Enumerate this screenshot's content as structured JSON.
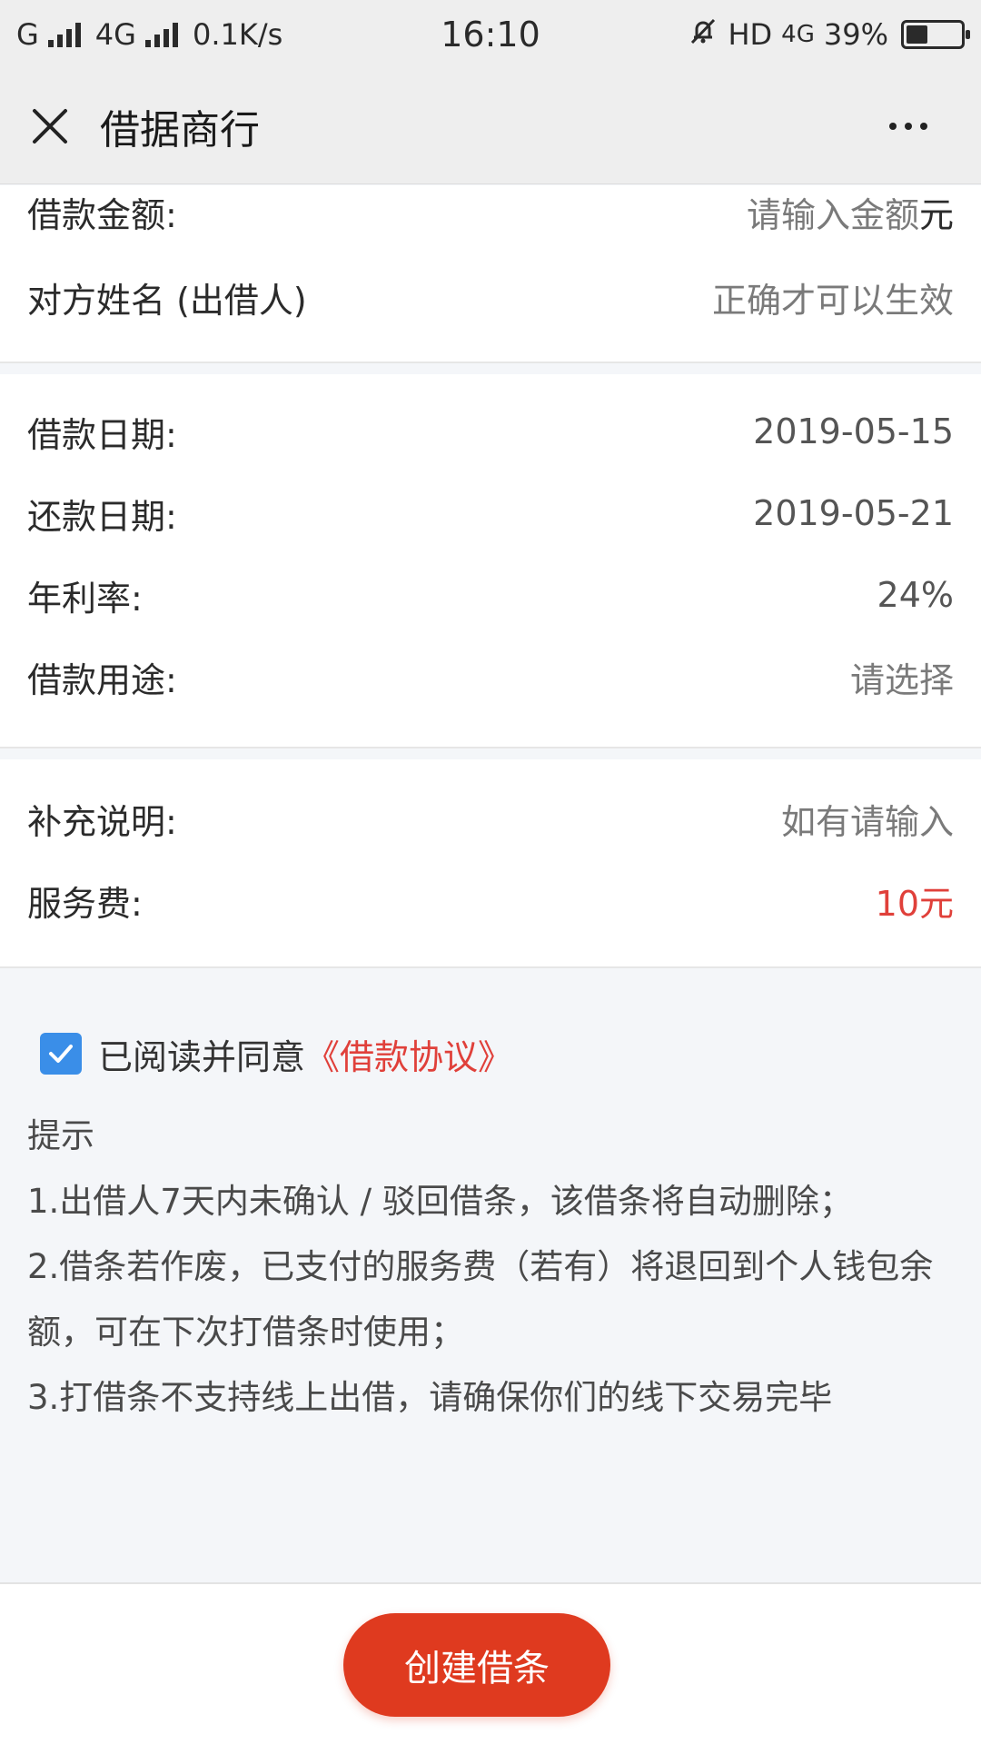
{
  "status_bar": {
    "carrier": "G",
    "network": "4G",
    "speed": "0.1K/s",
    "time": "16:10",
    "hd": "HD",
    "network2": "4G",
    "battery_percent": "39%",
    "battery_level": 0.39
  },
  "header": {
    "title": "借据商行",
    "close_icon": "close-icon",
    "more_icon": "more-dots-icon"
  },
  "form": {
    "amount": {
      "label": "借款金额:",
      "placeholder": "请输入金额",
      "unit": "元"
    },
    "lender_name": {
      "label": "对方姓名 (出借人)",
      "placeholder": "正确才可以生效"
    },
    "loan_date": {
      "label": "借款日期:",
      "value": "2019-05-15"
    },
    "repay_date": {
      "label": "还款日期:",
      "value": "2019-05-21"
    },
    "interest_rate": {
      "label": "年利率:",
      "value": "24%"
    },
    "purpose": {
      "label": "借款用途:",
      "placeholder": "请选择"
    },
    "note": {
      "label": "补充说明:",
      "placeholder": "如有请输入"
    },
    "service_fee": {
      "label": "服务费:",
      "value": "10元"
    }
  },
  "agreement": {
    "checked": true,
    "text": "已阅读并同意",
    "link": "《借款协议》"
  },
  "tips": {
    "title": "提示",
    "items": [
      "1.出借人7天内未确认 / 驳回借条，该借条将自动删除；",
      "2.借条若作废，已支付的服务费（若有）将退回到个人钱包余额，可在下次打借条时使用；",
      "3.打借条不支持线上出借，请确保你们的线下交易完毕"
    ]
  },
  "actions": {
    "create_label": "创建借条"
  },
  "colors": {
    "accent_red": "#df3a1f",
    "checkbox_blue": "#3a8ee8",
    "fee_red": "#e0403a"
  }
}
